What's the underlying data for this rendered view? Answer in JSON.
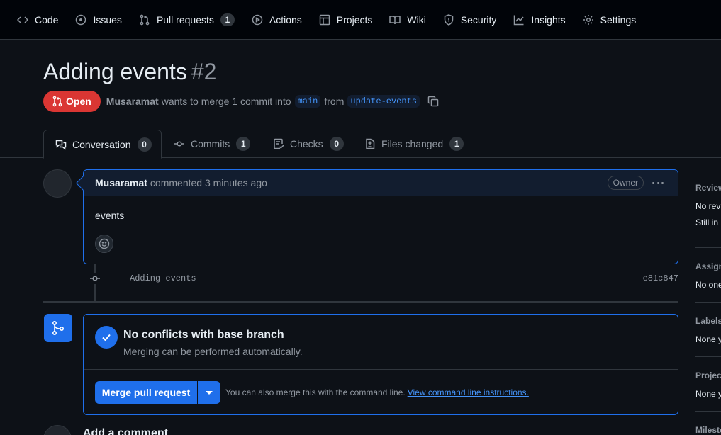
{
  "nav": {
    "code": "Code",
    "issues": "Issues",
    "pull_requests": "Pull requests",
    "pull_requests_count": "1",
    "actions": "Actions",
    "projects": "Projects",
    "wiki": "Wiki",
    "security": "Security",
    "insights": "Insights",
    "settings": "Settings"
  },
  "pr": {
    "title": "Adding events",
    "number": "#2",
    "state": "Open",
    "author": "Musaramat",
    "meta_text": "wants to merge 1 commit into",
    "base_branch": "main",
    "from_text": "from",
    "head_branch": "update-events",
    "state_color": "#da3633"
  },
  "tabs": [
    {
      "label": "Conversation",
      "count": "0"
    },
    {
      "label": "Commits",
      "count": "1"
    },
    {
      "label": "Checks",
      "count": "0"
    },
    {
      "label": "Files changed",
      "count": "1"
    }
  ],
  "comment": {
    "author": "Musaramat",
    "action": "commented 3 minutes ago",
    "badge": "Owner",
    "body": "events"
  },
  "commit": {
    "message": "Adding events",
    "sha": "e81c847"
  },
  "merge": {
    "title": "No conflicts with base branch",
    "subtitle": "Merging can be performed automatically.",
    "button": "Merge pull request",
    "hint": "You can also merge this with the command line.",
    "hint_link": "View command line instructions.",
    "accent": "#1f6feb"
  },
  "add_comment": {
    "title": "Add a comment"
  },
  "sidebar": {
    "reviewers": {
      "head": "Reviewers",
      "line1": "No reviews",
      "line2": "Still in progress?"
    },
    "assignees": {
      "head": "Assignees",
      "line1": "No one—"
    },
    "labels": {
      "head": "Labels",
      "line1": "None yet"
    },
    "projects": {
      "head": "Projects",
      "line1": "None yet"
    },
    "milestone": {
      "head": "Milestone"
    }
  }
}
